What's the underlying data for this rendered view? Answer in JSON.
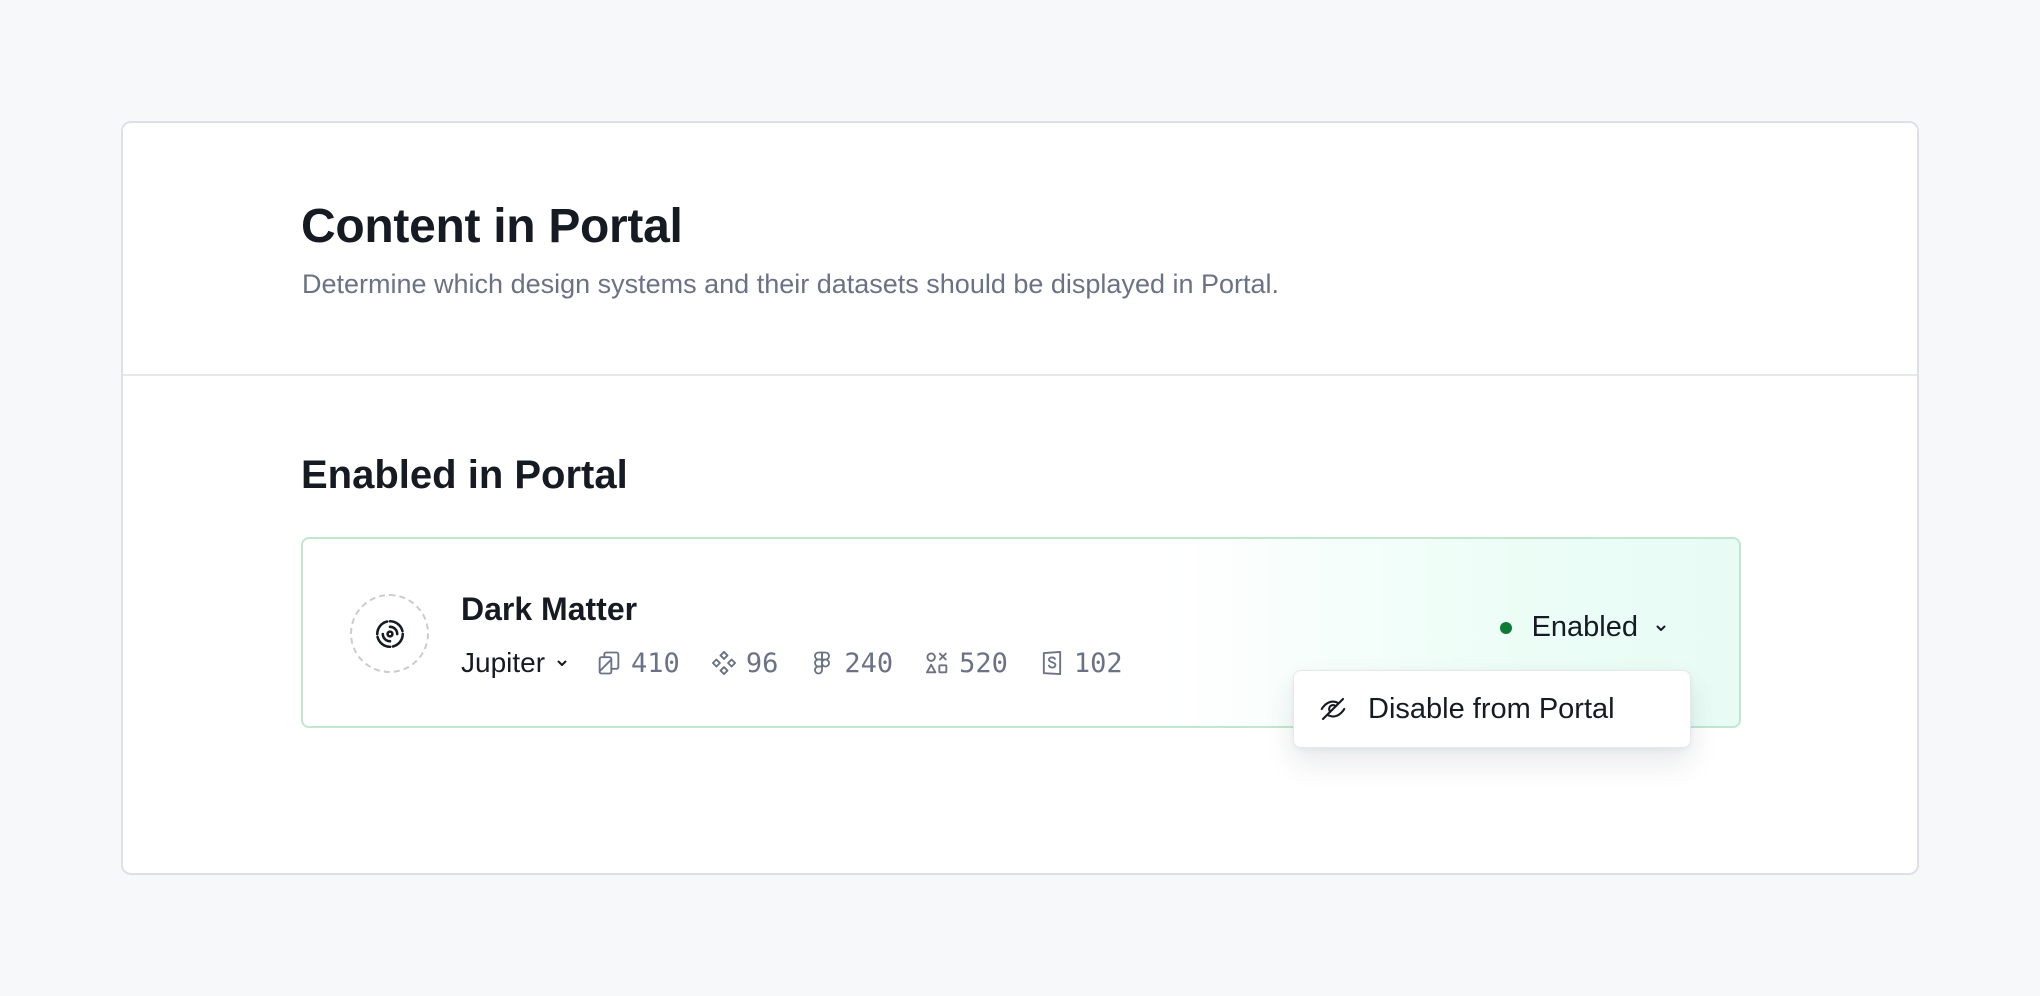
{
  "header": {
    "title": "Content in Portal",
    "subtitle": "Determine which design systems and their datasets should be displayed in Portal."
  },
  "section": {
    "title": "Enabled in Portal"
  },
  "design_system": {
    "name": "Dark Matter",
    "logo_icon": "spiral-logo-icon",
    "version": "Jupiter",
    "stats": [
      {
        "icon": "documentation-pages-icon",
        "value": "410"
      },
      {
        "icon": "components-icon",
        "value": "96"
      },
      {
        "icon": "figma-icon",
        "value": "240"
      },
      {
        "icon": "assets-icon",
        "value": "520"
      },
      {
        "icon": "storybook-icon",
        "value": "102"
      }
    ],
    "status": "Enabled",
    "status_color": "#0d7a37"
  },
  "dropdown_menu": {
    "items": [
      {
        "label": "Disable from Portal",
        "icon": "eye-off-icon"
      }
    ]
  },
  "colors": {
    "background": "#f7f8fa",
    "card": "#ffffff",
    "row_border": "#bfe8cd",
    "row_gradient_end": "#e8fcf5",
    "muted_text": "#6b7285"
  }
}
